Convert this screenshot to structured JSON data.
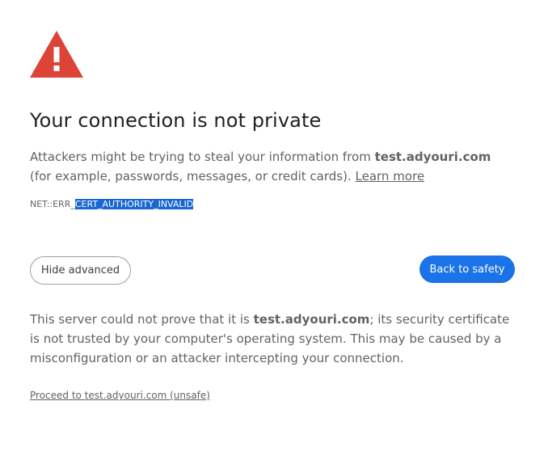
{
  "heading": "Your connection is not private",
  "explanation": {
    "part1": "Attackers might be trying to steal your information from ",
    "host": "test.adyouri.com",
    "part2": " (for example, passwords, messages, or credit cards). ",
    "learn_more": "Learn more"
  },
  "error_code": {
    "prefix": "NET::ERR_",
    "selected": "CERT_AUTHORITY_INVALID"
  },
  "buttons": {
    "hide_advanced": "Hide advanced",
    "back_to_safety": "Back to safety"
  },
  "details": {
    "part1": "This server could not prove that it is ",
    "host": "test.adyouri.com",
    "part2": "; its security certificate is not trusted by your computer's operating system. This may be caused by a misconfiguration or an attacker intercepting your connection."
  },
  "proceed_link": "Proceed to test.adyouri.com (unsafe)",
  "colors": {
    "warning_red": "#db4437",
    "primary_blue": "#1a73e8",
    "text_gray": "#5f6368",
    "selection_blue": "#1967d2"
  },
  "icon": "warning-triangle-icon"
}
